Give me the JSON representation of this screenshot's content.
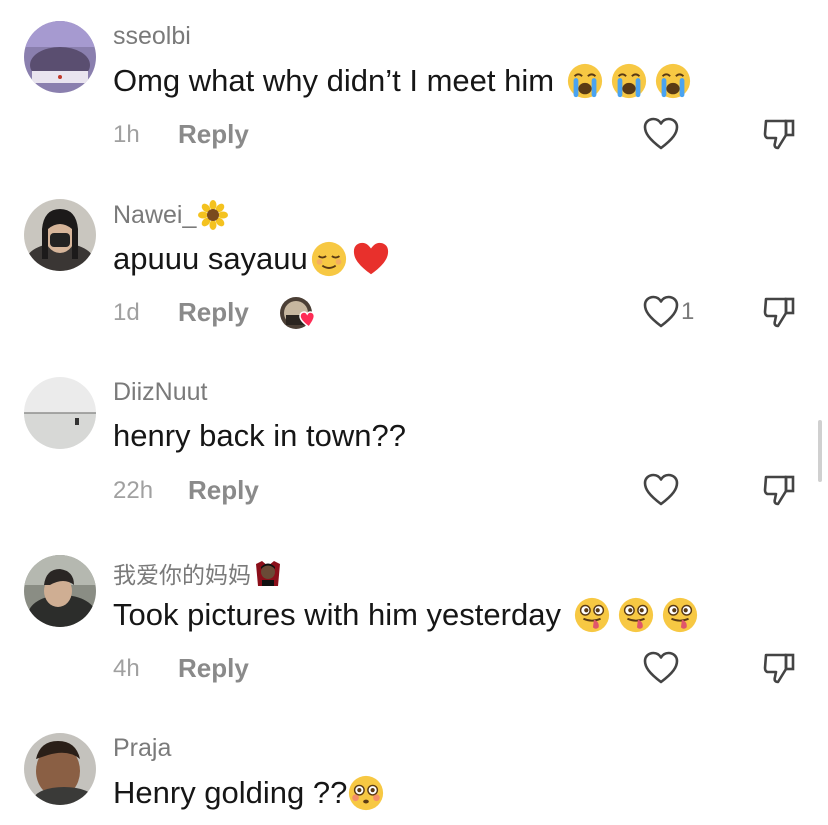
{
  "comments": [
    {
      "username": "sseolbi",
      "text": "Omg what why didn’t I meet him",
      "time": "1h",
      "reply": "Reply",
      "emojis": [
        "loudly-crying-face",
        "loudly-crying-face",
        "loudly-crying-face"
      ],
      "likes": ""
    },
    {
      "username": "Nawei_",
      "username_emoji": "sunflower",
      "text": "apuuu sayauu",
      "time": "1d",
      "reply": "Reply",
      "emojis": [
        "relieved-face",
        "red-heart"
      ],
      "likes": "1",
      "liked_by_creator": true
    },
    {
      "username": "DiizNuut",
      "text": "henry back in town??",
      "time": "22h",
      "reply": "Reply",
      "emojis": [],
      "likes": ""
    },
    {
      "username": "我爱你的妈妈",
      "username_emoji": "vampire",
      "text": "Took pictures with him yesterday",
      "time": "4h",
      "reply": "Reply",
      "emojis": [
        "winking-face-with-tongue",
        "winking-face-with-tongue",
        "winking-face-with-tongue"
      ],
      "likes": ""
    },
    {
      "username": "Praja",
      "text": "Henry golding ??",
      "emojis": [
        "flushed-face"
      ]
    }
  ],
  "icons": {
    "like": "heart-outline-icon",
    "dislike": "thumbs-down-outline-icon"
  },
  "colors": {
    "username": "#7a7a7a",
    "text": "#161616",
    "meta": "#a0a0a0",
    "reply": "#8a8a8a"
  }
}
